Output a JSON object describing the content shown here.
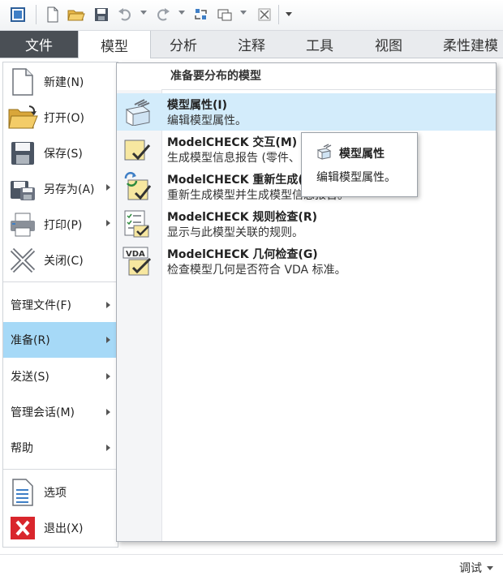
{
  "ribbon": {
    "tabs": [
      {
        "label": "文件"
      },
      {
        "label": "模型"
      },
      {
        "label": "分析"
      },
      {
        "label": "注释"
      },
      {
        "label": "工具"
      },
      {
        "label": "视图"
      },
      {
        "label": "柔性建模"
      }
    ]
  },
  "file_menu": {
    "items": [
      {
        "label": "新建(N)"
      },
      {
        "label": "打开(O)"
      },
      {
        "label": "保存(S)"
      },
      {
        "label": "另存为(A)"
      },
      {
        "label": "打印(P)"
      },
      {
        "label": "关闭(C)"
      }
    ],
    "text_items": [
      {
        "label": "管理文件(F)"
      },
      {
        "label": "准备(R)"
      },
      {
        "label": "发送(S)"
      },
      {
        "label": "管理会话(M)"
      },
      {
        "label": "帮助"
      }
    ],
    "bottom_items": [
      {
        "label": "选项"
      },
      {
        "label": "退出(X)"
      }
    ]
  },
  "submenu": {
    "title": "准备要分布的模型",
    "items": [
      {
        "title": "模型属性(I)",
        "desc": "编辑模型属性。"
      },
      {
        "title": "ModelCHECK 交互(M)",
        "desc": "生成模型信息报告 (零件、"
      },
      {
        "title": "ModelCHECK 重新生成(",
        "desc": "重新生成模型并生成模型信息报告。"
      },
      {
        "title": "ModelCHECK 规则检查(R)",
        "desc": "显示与此模型关联的规则。"
      },
      {
        "title": "ModelCHECK 几何检查(G)",
        "desc": "检查模型几何是否符合 VDA 标准。"
      }
    ]
  },
  "tooltip": {
    "title": "模型属性",
    "desc": "编辑模型属性。"
  },
  "status": {
    "debug_label": "调试"
  },
  "colors": {
    "file_tab_bg": "#4a4f55",
    "selected_bg": "#a6d9f7",
    "hover_bg": "#d3ecfb",
    "exit_red": "#d9262c"
  }
}
